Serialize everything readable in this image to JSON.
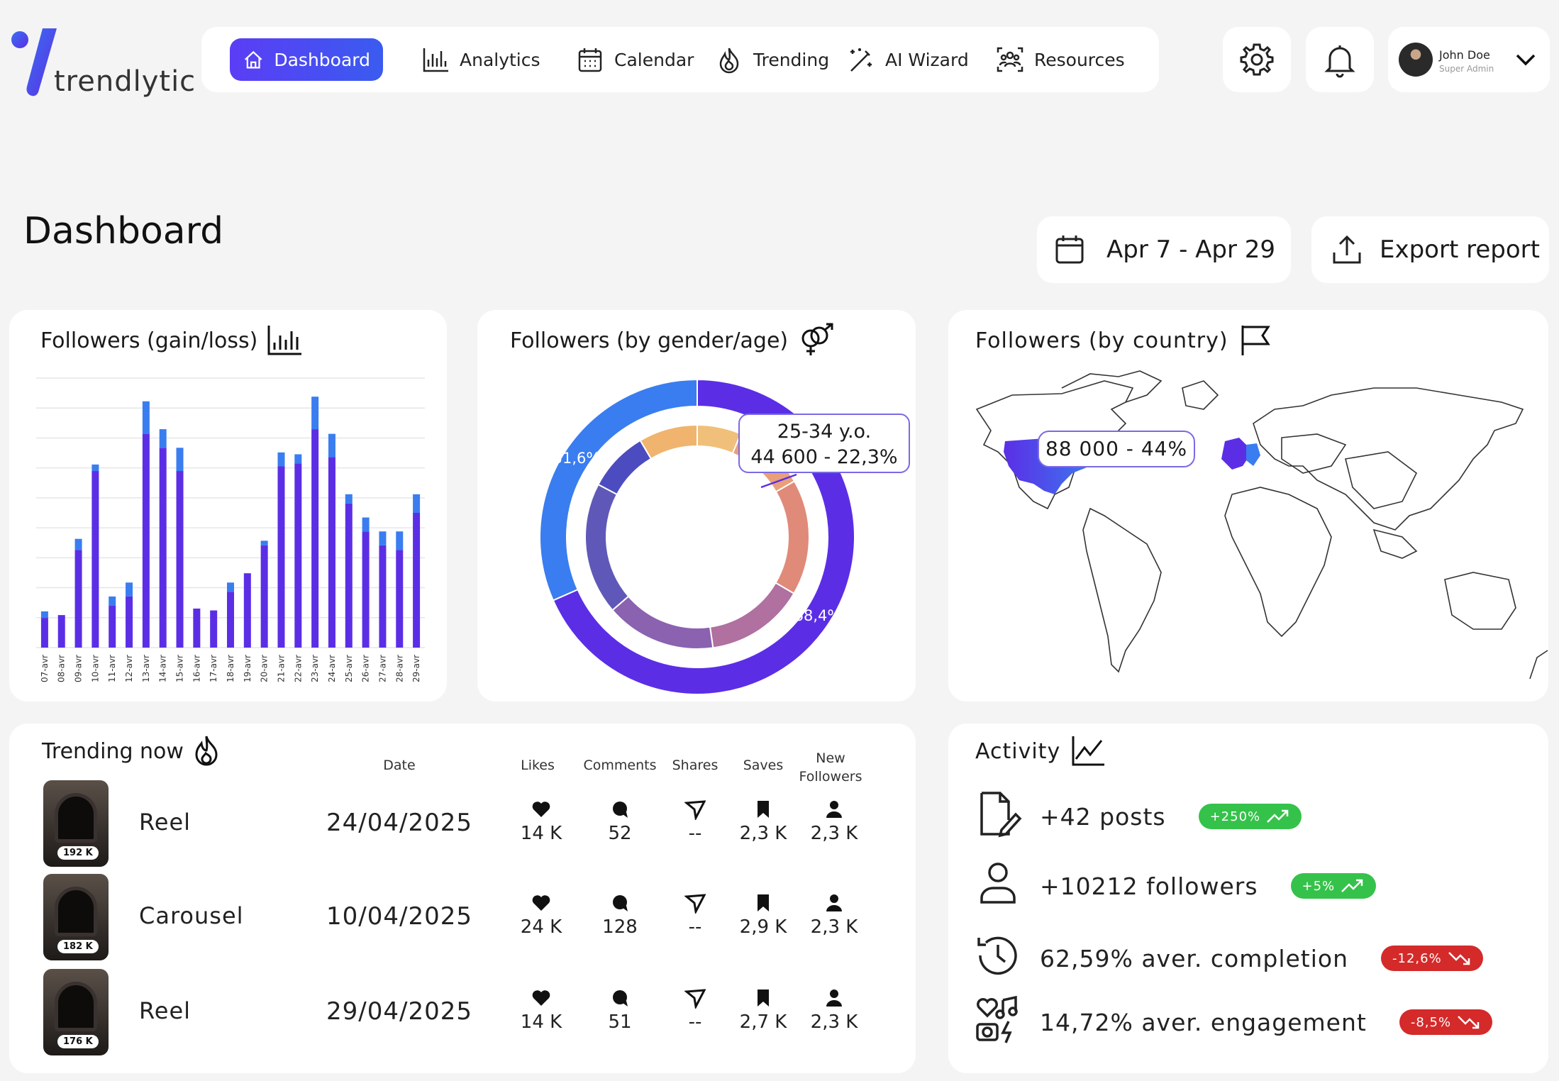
{
  "brand": {
    "name": "trendlytic"
  },
  "nav": {
    "items": [
      {
        "label": "Dashboard",
        "icon": "home-icon",
        "active": true
      },
      {
        "label": "Analytics",
        "icon": "bar-chart-icon"
      },
      {
        "label": "Calendar",
        "icon": "calendar-icon"
      },
      {
        "label": "Trending",
        "icon": "flame-icon"
      },
      {
        "label": "AI Wizard",
        "icon": "magic-wand-icon"
      },
      {
        "label": "Resources",
        "icon": "people-group-icon"
      }
    ]
  },
  "header": {
    "settings_icon": "gear-icon",
    "notifications_icon": "bell-icon",
    "user": {
      "name": "John Doe",
      "role": "Super Admin"
    }
  },
  "page": {
    "title": "Dashboard",
    "date_range": "Apr 7 - Apr 29",
    "export_label": "Export report"
  },
  "colors": {
    "primary": "#5b2ee6",
    "accent_blue": "#3a7df0",
    "peach": "#f0b46e",
    "green": "#35c24a",
    "red": "#d42a2a"
  },
  "cards": {
    "gain_loss": {
      "title": "Followers (gain/loss)"
    },
    "gender_age": {
      "title": "Followers (by gender/age)"
    },
    "country": {
      "title": "Followers (by country)",
      "tooltip": "88 000 - 44%"
    },
    "trending": {
      "title": "Trending now"
    },
    "activity": {
      "title": "Activity"
    }
  },
  "chart_data": [
    {
      "type": "bar",
      "title": "Followers (gain/loss)",
      "categories": [
        "07-avr",
        "08-avr",
        "09-avr",
        "10-avr",
        "11-avr",
        "12-avr",
        "13-avr",
        "14-avr",
        "15-avr",
        "16-avr",
        "17-avr",
        "18-avr",
        "19-avr",
        "20-avr",
        "21-avr",
        "22-avr",
        "23-avr",
        "24-avr",
        "25-avr",
        "26-avr",
        "27-avr",
        "28-avr",
        "29-avr"
      ],
      "series": [
        {
          "color": "#5b2ee6",
          "values": [
            32,
            35,
            105,
            190,
            45,
            55,
            230,
            215,
            190,
            42,
            40,
            60,
            80,
            110,
            195,
            198,
            235,
            205,
            155,
            125,
            110,
            105,
            145
          ]
        },
        {
          "color": "#3a7df0",
          "values": [
            7,
            0,
            12,
            7,
            10,
            15,
            35,
            20,
            25,
            0,
            0,
            10,
            0,
            5,
            15,
            10,
            35,
            25,
            10,
            15,
            15,
            20,
            20
          ]
        }
      ],
      "ylim": [
        0,
        290
      ],
      "grid": true
    },
    {
      "type": "pie",
      "title": "Followers (by gender/age)",
      "outer": [
        {
          "label": "68,4%",
          "value": 68.4,
          "color": "#5b2ee6"
        },
        {
          "label": "31,6%",
          "value": 31.6,
          "color": "#3a7df0"
        }
      ],
      "inner_tooltip": {
        "line1": "25-34 y.o.",
        "line2": "44 600 - 22,3%"
      }
    }
  ],
  "trending": {
    "headers": {
      "date": "Date",
      "likes": "Likes",
      "comments": "Comments",
      "shares": "Shares",
      "saves": "Saves",
      "new_followers": "New Followers"
    },
    "rows": [
      {
        "type": "Reel",
        "date": "24/04/2025",
        "views": "192 K",
        "likes": "14 K",
        "comments": "52",
        "shares": "--",
        "saves": "2,3 K",
        "new_followers": "2,3 K"
      },
      {
        "type": "Carousel",
        "date": "10/04/2025",
        "views": "182 K",
        "likes": "24 K",
        "comments": "128",
        "shares": "--",
        "saves": "2,9 K",
        "new_followers": "2,3 K"
      },
      {
        "type": "Reel",
        "date": "29/04/2025",
        "views": "176 K",
        "likes": "14 K",
        "comments": "51",
        "shares": "--",
        "saves": "2,7 K",
        "new_followers": "2,3 K"
      }
    ]
  },
  "activity": [
    {
      "text": "+42 posts",
      "badge": "+250%",
      "trend": "up",
      "icon": "document-edit-icon"
    },
    {
      "text": "+10212 followers",
      "badge": "+5%",
      "trend": "up",
      "icon": "user-icon"
    },
    {
      "text": "62,59% aver. completion",
      "badge": "-12,6%",
      "trend": "down",
      "icon": "history-icon"
    },
    {
      "text": "14,72% aver. engagement",
      "badge": "-8,5%",
      "trend": "down",
      "icon": "engagement-icon"
    }
  ]
}
